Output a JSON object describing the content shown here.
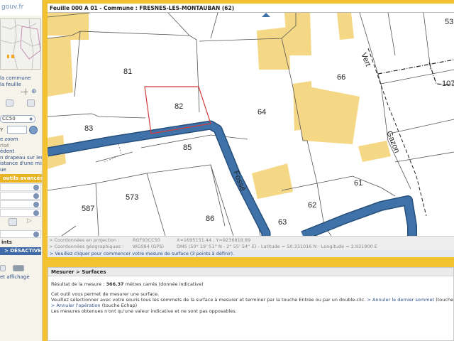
{
  "site": {
    "logo_text": "gouv.fr"
  },
  "left_panel": {
    "links": [
      "la commune",
      "la feuille"
    ],
    "select_value": "CC50",
    "y_label": "Y",
    "info_lines": [
      {
        "text": "e zoom",
        "tone": "link"
      },
      {
        "text": "risé",
        "tone": "grey"
      },
      {
        "text": "édent",
        "tone": "link"
      },
      {
        "text": "n drapeau sur les",
        "tone": "link"
      },
      {
        "text": "istance d'une mise",
        "tone": "link"
      },
      {
        "text": "ue",
        "tone": "link"
      }
    ],
    "advanced_tools": "outils avancés",
    "points_label": "ints",
    "deactivate_label": "> DÉSACTIVER",
    "print_label": "et affichage"
  },
  "map": {
    "title": "Feuille 000 A 01 - Commune : FRESNES-LES-MONTAUBAN (62)",
    "parcels": [
      {
        "id": "p81",
        "label": "81"
      },
      {
        "id": "p82",
        "label": "82"
      },
      {
        "id": "p83",
        "label": "83"
      },
      {
        "id": "p64",
        "label": "64"
      },
      {
        "id": "p66",
        "label": "66"
      },
      {
        "id": "p107",
        "label": "107"
      },
      {
        "id": "p53",
        "label": "53"
      },
      {
        "id": "p85",
        "label": "85"
      },
      {
        "id": "p573",
        "label": "573"
      },
      {
        "id": "p587",
        "label": "587"
      },
      {
        "id": "p86",
        "label": "86"
      },
      {
        "id": "p62",
        "label": "62"
      },
      {
        "id": "p61",
        "label": "61"
      },
      {
        "id": "p63",
        "label": "63"
      }
    ],
    "streets": [
      {
        "id": "fosse",
        "label": "Fossé"
      },
      {
        "id": "vert",
        "label": "Vert"
      },
      {
        "id": "gazon",
        "label": "Gazon"
      }
    ],
    "colors": {
      "road": "#3e72a8",
      "road_edge": "#274f7c",
      "building": "#f5d885",
      "building_edge": "#e3c26a",
      "selection": "#d23b3b"
    }
  },
  "coords": {
    "projection_label": "> Coordonnées en projection :",
    "projection_system": "RGF93CC50",
    "projection_value": "X=1695151.44 ; Y=9236818.89",
    "geo_label": "> Coordonnées géographiques :",
    "geo_system": "WGS84 (GPS)",
    "geo_value": "DMS (50° 19' 51'' N - 2° 55' 54'' E) - Latitude = 50.331016 N - Longitude = 2.931900 E"
  },
  "hint": "> Veuillez cliquer pour commencer votre mesure de surface (3 points à définir).",
  "measure": {
    "title": "Mesurer > Surfaces",
    "result_prefix": "Résultat de la mesure :",
    "result_value": "366.37",
    "result_suffix": "mètres carrés   (donnée indicative)",
    "desc1": "Cet outil vous permet de mesurer une surface.",
    "desc2": "Veuillez sélectionner avec votre souris tous les sommets de la surface à mesurer et terminer par la touche Entrée ou par un double-clic.",
    "undo_link": "> Annuler le dernier sommet",
    "undo_hint": "(touche Retour)",
    "cancel_link": "> Annuler l'opération",
    "cancel_hint": "(touche Echap)",
    "disclaimer": "Les mesures obtenues n'ont qu'une valeur indicative et ne sont pas opposables."
  }
}
